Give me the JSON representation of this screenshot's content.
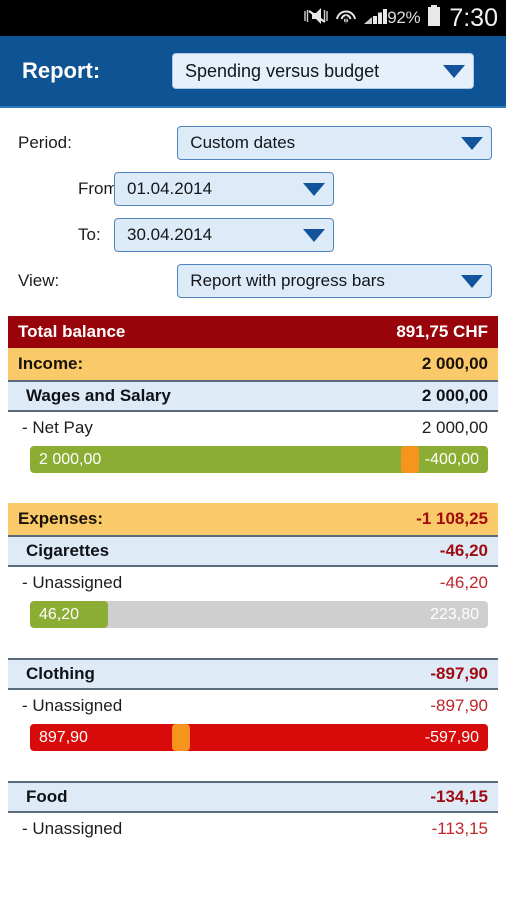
{
  "statusbar": {
    "icons": [
      "mute-icon",
      "wifi-icon",
      "signal-icon"
    ],
    "battery_percent": "92%",
    "battery_icon": "battery-icon",
    "time": "7:30"
  },
  "appbar": {
    "title": "Report:",
    "report_select": {
      "value": "Spending versus budget",
      "arrow_icon": "chevron-down-icon"
    }
  },
  "form": {
    "period_label": "Period:",
    "period_value": "Custom dates",
    "from_label": "From:",
    "from_value": "01.04.2014",
    "to_label": "To:",
    "to_value": "30.04.2014",
    "view_label": "View:",
    "view_value": "Report with progress bars"
  },
  "report": {
    "total": {
      "label": "Total balance",
      "amount": "891,75 CHF"
    },
    "sections": [
      {
        "group": {
          "label": "Income:",
          "amount": "2 000,00",
          "negative": false
        },
        "categories": [
          {
            "label": "Wages and Salary",
            "amount": "2 000,00",
            "negative": false,
            "items": [
              {
                "label": "- Net Pay",
                "amount": "2 000,00",
                "negative": false,
                "bar": {
                  "style": "full-green",
                  "left_text": "2 000,00",
                  "right_text": "-400,00",
                  "marker": true,
                  "marker_percent": 83,
                  "fill_percent": 100
                }
              }
            ]
          }
        ]
      },
      {
        "group": {
          "label": "Expenses:",
          "amount": "-1 108,25",
          "negative": true
        },
        "categories": [
          {
            "label": "Cigarettes",
            "amount": "-46,20",
            "negative": true,
            "items": [
              {
                "label": "- Unassigned",
                "amount": "-46,20",
                "negative": true,
                "bar": {
                  "style": "track-grey",
                  "left_text": "46,20",
                  "right_text": "223,80",
                  "marker": false,
                  "marker_percent": 0,
                  "fill_percent": 17
                }
              }
            ]
          },
          {
            "label": "Clothing",
            "amount": "-897,90",
            "negative": true,
            "items": [
              {
                "label": "- Unassigned",
                "amount": "-897,90",
                "negative": true,
                "bar": {
                  "style": "full-red",
                  "left_text": "897,90",
                  "right_text": "-597,90",
                  "marker": true,
                  "marker_percent": 33,
                  "fill_percent": 100
                }
              }
            ]
          },
          {
            "label": "Food",
            "amount": "-134,15",
            "negative": true,
            "items": [
              {
                "label": "- Unassigned",
                "amount": "-113,15",
                "negative": true,
                "bar": null
              }
            ]
          }
        ]
      }
    ]
  },
  "colors": {
    "appbar_blue": "#0e5494",
    "total_red": "#99040b",
    "group_orange": "#fac96a",
    "category_blue": "#dfeaf7",
    "bar_green": "#8cad34",
    "bar_red": "#d90a0a",
    "bar_grey": "#cfcfcf",
    "marker_orange": "#f7941d",
    "negative_text": "#c0262b"
  }
}
